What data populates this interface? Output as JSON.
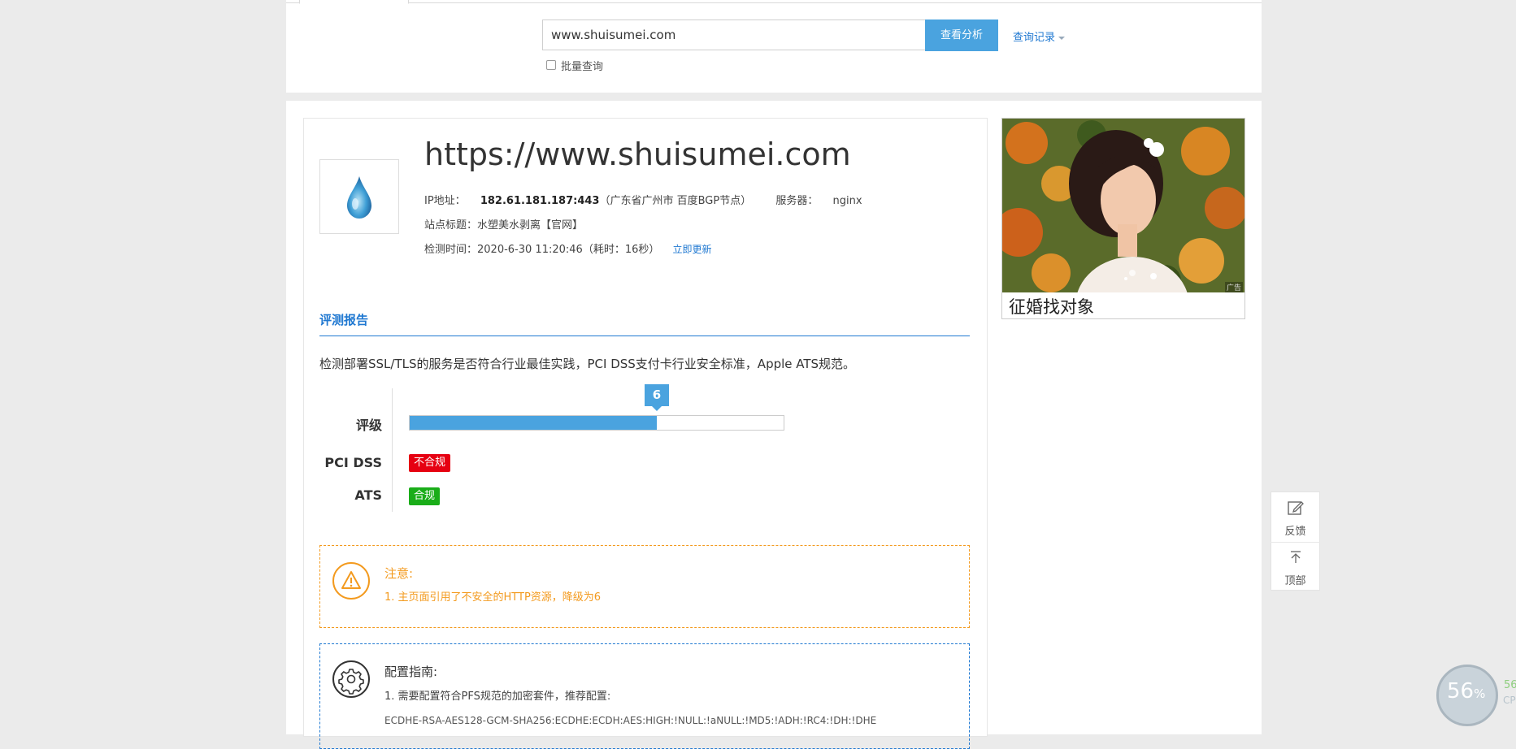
{
  "search": {
    "input_value": "www.shuisumei.com",
    "button_label": "查看分析",
    "history_label": "查询记录",
    "batch_label": "批量查询"
  },
  "site": {
    "url": "https://www.shuisumei.com",
    "ip_label": "IP地址：",
    "ip_value": "182.61.181.187:443",
    "ip_location": "（广东省广州市 百度BGP节点）",
    "server_label": "服务器：",
    "server_value": "nginx",
    "title_label": "站点标题：",
    "title_value": "水塑美水剥离【官网】",
    "check_label": "检测时间：",
    "check_value": "2020-6-30 11:20:46（耗时：16秒）",
    "refresh_label": "立即更新"
  },
  "report": {
    "section_title": "评测报告",
    "description": "检测部署SSL/TLS的服务是否符合行业最佳实践，PCI DSS支付卡行业安全标准，Apple ATS规范。",
    "grade_label": "评级",
    "grade_value": "6",
    "grade_fraction": 0.66,
    "pci_label": "PCI DSS",
    "pci_status": "不合规",
    "pci_color": "#e60012",
    "ats_label": "ATS",
    "ats_status": "合规",
    "ats_color": "#1aad19"
  },
  "notice": {
    "title": "注意:",
    "item": "1. 主页面引用了不安全的HTTP资源，降级为6",
    "color": "#f39a1e"
  },
  "guide": {
    "title": "配置指南:",
    "item": "1. 需要配置符合PFS规范的加密套件，推荐配置:",
    "code": "ECDHE-RSA-AES128-GCM-SHA256:ECDHE:ECDH:AES:HIGH:!NULL:!aNULL:!MD5:!ADH:!RC4:!DH:!DHE"
  },
  "ad": {
    "caption": "征婚找对象",
    "tag": "广告"
  },
  "float": {
    "feedback": "反馈",
    "top": "顶部"
  },
  "cpu": {
    "percent": "56",
    "unit": "%",
    "side_value": "56",
    "side_label": "CP"
  }
}
